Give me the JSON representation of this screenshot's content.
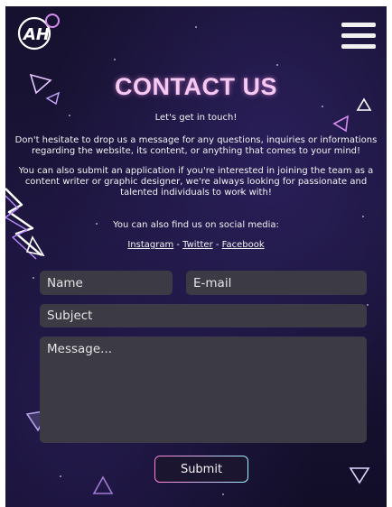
{
  "header": {
    "logo_text": "AH",
    "menu_icon": "hamburger-menu-icon"
  },
  "main": {
    "title": "CONTACT US",
    "subtitle": "Let's get in touch!",
    "paragraph1": "Don't hesitate to drop us a message for any questions, inquiries or informations regarding the website, its content, or anything that comes to your mind!",
    "paragraph2": "You can also submit an application if you're interested in joining the team as a content writer or graphic designer, we're always looking for passionate and talented individuals to work with!",
    "social_intro": "You can also find us on social media:",
    "social_links": [
      {
        "label": "Instagram"
      },
      {
        "label": "Twitter"
      },
      {
        "label": "Facebook"
      }
    ],
    "separator": " - "
  },
  "form": {
    "name_placeholder": "Name",
    "email_placeholder": "E-mail",
    "subject_placeholder": "Subject",
    "message_placeholder": "Message...",
    "submit_label": "Submit"
  },
  "colors": {
    "background": "#16112f",
    "title": "#f6c9f2",
    "field": "#3b3a45",
    "accent_pink": "#ff7fd6",
    "accent_cyan": "#9ff3ff"
  }
}
